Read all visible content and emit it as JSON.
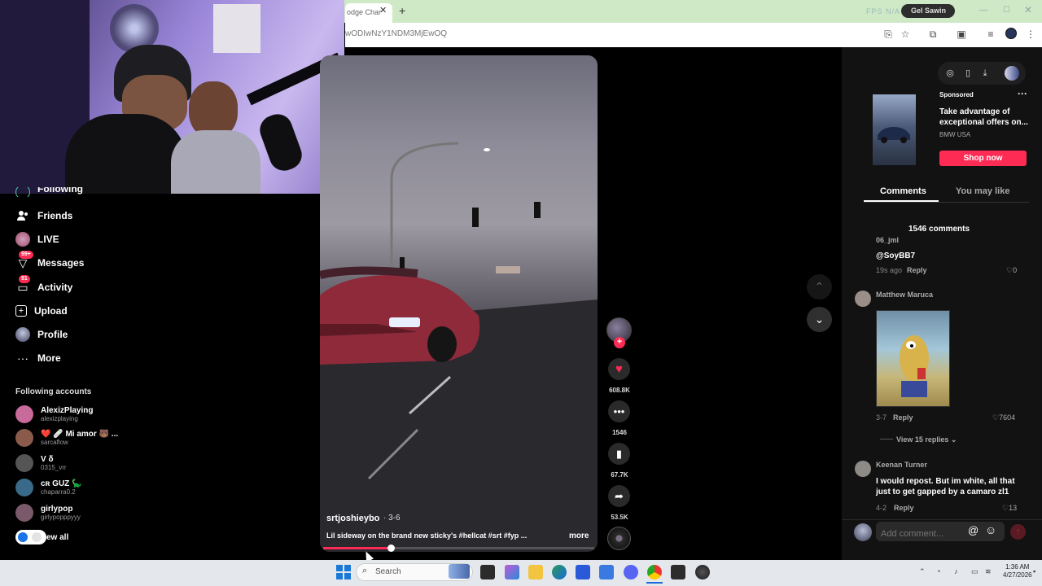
{
  "browser": {
    "tab_title": "odge Char",
    "url": "wODIwNzY1NDM3MjEwOQ",
    "perf_overlay": "FPS N/A",
    "profile_chip": "Gel Sawin"
  },
  "sidebar": {
    "following_partial": "Following",
    "items": [
      {
        "label": "Friends",
        "icon": "friends-icon"
      },
      {
        "label": "LIVE",
        "icon": "live-icon"
      },
      {
        "label": "Messages",
        "icon": "messages-icon",
        "badge": "99+"
      },
      {
        "label": "Activity",
        "icon": "activity-icon",
        "badge": "91"
      },
      {
        "label": "Upload",
        "icon": "upload-icon"
      },
      {
        "label": "Profile",
        "icon": "profile-icon"
      },
      {
        "label": "More",
        "icon": "more-icon"
      }
    ],
    "following_title": "Following accounts",
    "accounts": [
      {
        "name": "AlexizPlaying",
        "handle": "alexizplaying",
        "color": "#c86a9a"
      },
      {
        "name": "❤️ 🩹 Mi amor 🐻 ...",
        "handle": "sarcaflow",
        "color": "#8a5a4a"
      },
      {
        "name": "V δ",
        "handle": "0315_vrr",
        "color": "#555"
      },
      {
        "name": "cʀ GUZ 🦕",
        "handle": "chaparra0.2",
        "color": "#3a6a8a"
      },
      {
        "name": "girlypop",
        "handle": "girlypopppyyy",
        "color": "#7a5a6a"
      }
    ],
    "view_all": "ew all"
  },
  "video": {
    "author": "srtjoshieybo",
    "date": "· 3-6",
    "caption": "Lil sideway on the brand new sticky's #hellcat #srt #fyp ...",
    "more": "more",
    "progress": 0.25
  },
  "rail": {
    "likes": "608.8K",
    "comments": "1546",
    "saves": "67.7K",
    "shares": "53.5K"
  },
  "ad": {
    "sponsored": "Sponsored",
    "title": "Take advantage of exceptional offers on...",
    "brand": "BMW USA",
    "cta": "Shop now"
  },
  "comments_panel": {
    "tab_comments": "Comments",
    "tab_like": "You may like",
    "count": "1546 comments",
    "items": [
      {
        "user": "06_jml",
        "text": "@SoyBB7",
        "meta": "19s ago",
        "reply": "Reply",
        "likes": "0"
      },
      {
        "user": "Matthew Maruca",
        "text": "",
        "meta": "3-7",
        "reply": "Reply",
        "likes": "7604",
        "view_replies": "View 15 replies"
      },
      {
        "user": "Keenan Turner",
        "text": "I would repost. But im white, all that just to get gapped by a camaro zl1",
        "meta": "4-2",
        "reply": "Reply",
        "likes": "13"
      }
    ],
    "placeholder": "Add comment..."
  },
  "taskbar": {
    "search_label": "Search",
    "time": "1:36 AM",
    "date": "4/27/2026"
  }
}
